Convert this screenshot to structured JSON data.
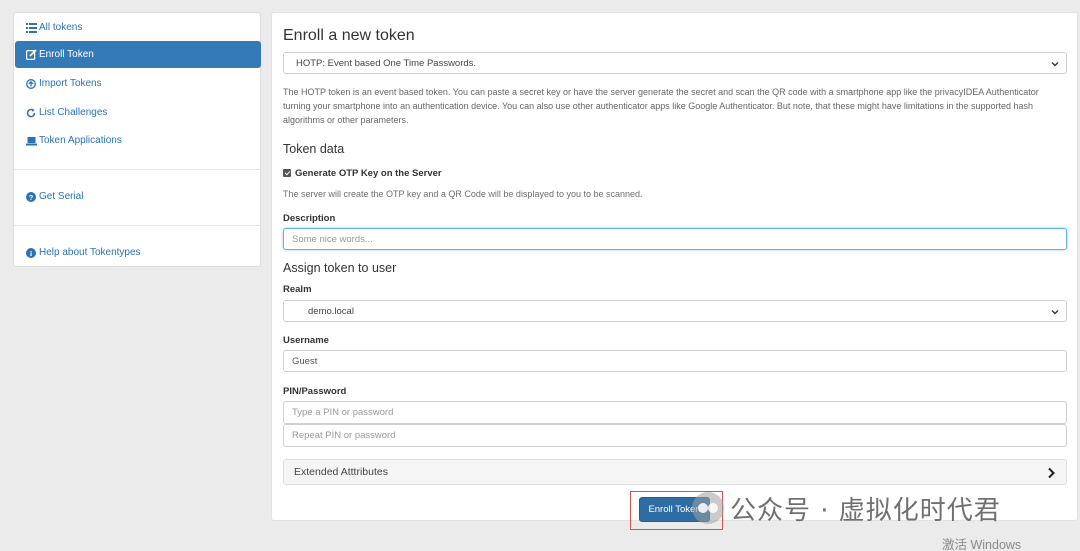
{
  "sidebar": {
    "items": [
      {
        "label": "All tokens",
        "icon": "list-icon"
      },
      {
        "label": "Enroll Token",
        "icon": "edit-icon",
        "active": true
      },
      {
        "label": "Import Tokens",
        "icon": "upload-circle-icon"
      },
      {
        "label": "List Challenges",
        "icon": "refresh-icon"
      },
      {
        "label": "Token Applications",
        "icon": "laptop-icon"
      },
      {
        "label": "Get Serial",
        "icon": "question-circle-icon"
      },
      {
        "label": "Help about Tokentypes",
        "icon": "info-circle-icon"
      }
    ]
  },
  "main": {
    "title": "Enroll a new token",
    "token_type": "HOTP: Event based One Time Passwords.",
    "description": "The HOTP token is an event based token. You can paste a secret key or have the server generate the secret and scan the QR code with a smartphone app like the privacyIDEA Authenticator turning your smartphone into an authentication device. You can also use other authenticator apps like Google Authenticator. But note, that these might have limitations in the supported hash algorithms or other parameters.",
    "token_data_heading": "Token data",
    "generate_label": "Generate OTP Key on the Server",
    "generate_help": "The server will create the OTP key and a QR Code will be displayed to you to be scanned.",
    "description_label": "Description",
    "description_placeholder": "Some nice words...",
    "assign_heading": "Assign token to user",
    "realm_label": "Realm",
    "realm_value": "demo.local",
    "username_label": "Username",
    "username_value": "Guest",
    "pin_label": "PIN/Password",
    "pin_placeholder": "Type a PIN or password",
    "pin_repeat_placeholder": "Repeat PIN or password",
    "extended_label": "Extended Atttributes",
    "enroll_button": "Enroll Token"
  },
  "overlay": {
    "watermark": "公众号 · 虚拟化时代君",
    "activate_windows": "激活 Windows"
  },
  "colors": {
    "primary": "#337ab7",
    "link": "#2a72b5",
    "highlight_outline": "#d9534f"
  }
}
